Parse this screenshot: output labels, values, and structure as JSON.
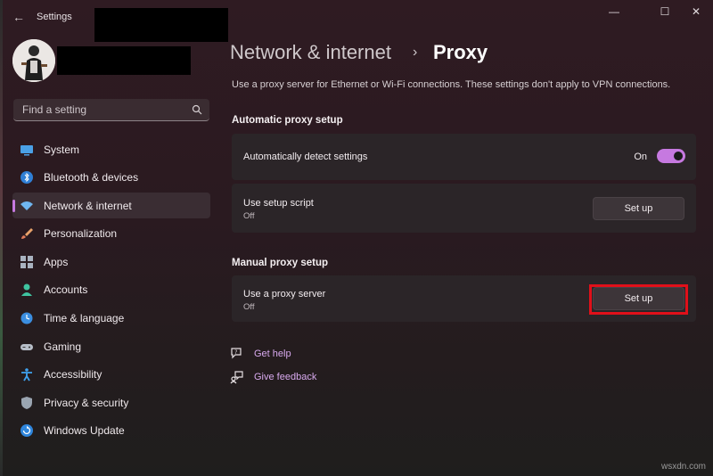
{
  "window": {
    "title": "Settings",
    "back_glyph": "←",
    "minimize_glyph": "—",
    "maximize_glyph": "☐",
    "close_glyph": "✕"
  },
  "search": {
    "placeholder": "Find a setting"
  },
  "sidebar": {
    "items": [
      {
        "label": "System",
        "icon": "display-icon"
      },
      {
        "label": "Bluetooth & devices",
        "icon": "bluetooth-icon"
      },
      {
        "label": "Network & internet",
        "icon": "wifi-icon",
        "active": true
      },
      {
        "label": "Personalization",
        "icon": "brush-icon"
      },
      {
        "label": "Apps",
        "icon": "apps-icon"
      },
      {
        "label": "Accounts",
        "icon": "person-icon"
      },
      {
        "label": "Time & language",
        "icon": "clock-globe-icon"
      },
      {
        "label": "Gaming",
        "icon": "gamepad-icon"
      },
      {
        "label": "Accessibility",
        "icon": "accessibility-icon"
      },
      {
        "label": "Privacy & security",
        "icon": "shield-icon"
      },
      {
        "label": "Windows Update",
        "icon": "update-icon"
      }
    ]
  },
  "header": {
    "parent": "Network & internet",
    "separator": "›",
    "current": "Proxy",
    "description": "Use a proxy server for Ethernet or Wi-Fi connections. These settings don't apply to VPN connections."
  },
  "automatic": {
    "heading": "Automatic proxy setup",
    "detect_label": "Automatically detect settings",
    "detect_state": "On",
    "script_label": "Use setup script",
    "script_sub": "Off",
    "script_button": "Set up"
  },
  "manual": {
    "heading": "Manual proxy setup",
    "proxy_label": "Use a proxy server",
    "proxy_sub": "Off",
    "proxy_button": "Set up"
  },
  "links": {
    "help": "Get help",
    "feedback": "Give feedback"
  },
  "watermark": "wsxdn.com",
  "colors": {
    "accent": "#c679e0",
    "highlight": "#e0101a",
    "link": "#d8a9ee"
  }
}
